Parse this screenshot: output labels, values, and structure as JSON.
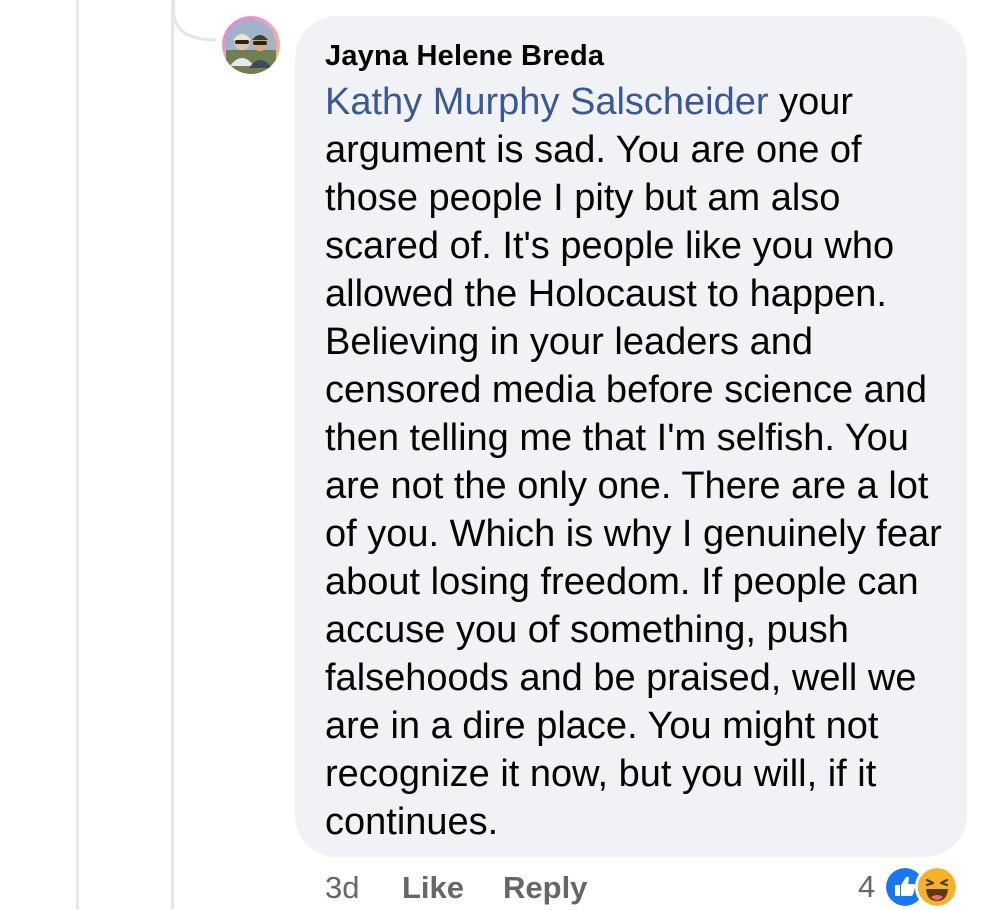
{
  "comment": {
    "author": "Jayna Helene Breda",
    "mention": "Kathy Murphy Salscheider",
    "text": " your argument is sad. You are one of those people I pity but am also scared of. It's people like you who allowed the Holocaust to happen. Believing in your leaders and censored media before science and then telling me that I'm selfish. You are not the only one. There are a lot of you. Which is why I genuinely fear about losing freedom. If people can accuse you of something, push falsehoods and be praised, well we are in a dire place. You might not recognize it now, but you will, if it continues."
  },
  "actions": {
    "time": "3d",
    "like_label": "Like",
    "reply_label": "Reply"
  },
  "reactions": {
    "count": "4",
    "icons": [
      "like-reaction-icon",
      "haha-reaction-icon"
    ]
  },
  "colors": {
    "mention": "#385898",
    "bubble": "#f0f2f5",
    "meta": "#65676b",
    "like_blue": "#1877f2",
    "haha_yellow": "#f7b125"
  }
}
